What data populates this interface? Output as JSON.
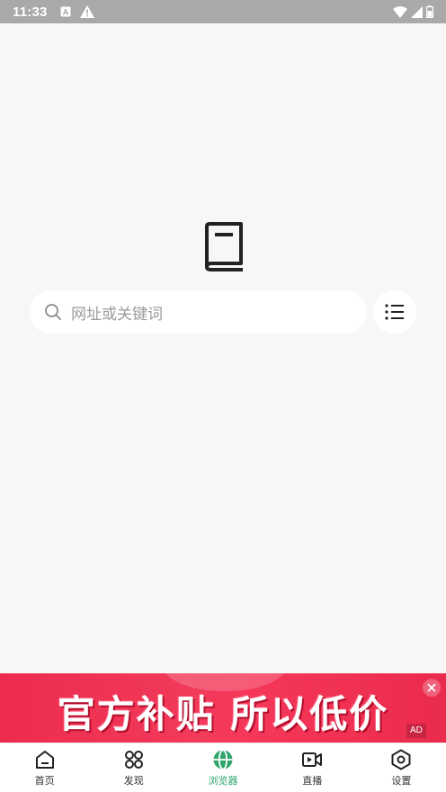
{
  "status_bar": {
    "time": "11:33",
    "icons": [
      "a-notification-icon",
      "warning-icon",
      "wifi-icon",
      "signal-icon",
      "battery-icon"
    ]
  },
  "browser": {
    "search": {
      "placeholder": "网址或关键词"
    },
    "icons": {
      "logo": "book-icon",
      "search": "search-icon",
      "menu": "list-menu-icon"
    }
  },
  "ad": {
    "slogan": "官方补贴 所以低价",
    "tag": "AD",
    "colors": {
      "background": "#f03758",
      "text": "#ffffff"
    }
  },
  "bottom_nav": {
    "items": [
      {
        "label": "首页",
        "icon": "home-icon",
        "active": false
      },
      {
        "label": "发现",
        "icon": "discover-icon",
        "active": false
      },
      {
        "label": "浏览器",
        "icon": "globe-icon",
        "active": true
      },
      {
        "label": "直播",
        "icon": "live-video-icon",
        "active": false
      },
      {
        "label": "设置",
        "icon": "settings-icon",
        "active": false
      }
    ],
    "colors": {
      "active": "#2ea66b",
      "inactive": "#333333"
    }
  }
}
